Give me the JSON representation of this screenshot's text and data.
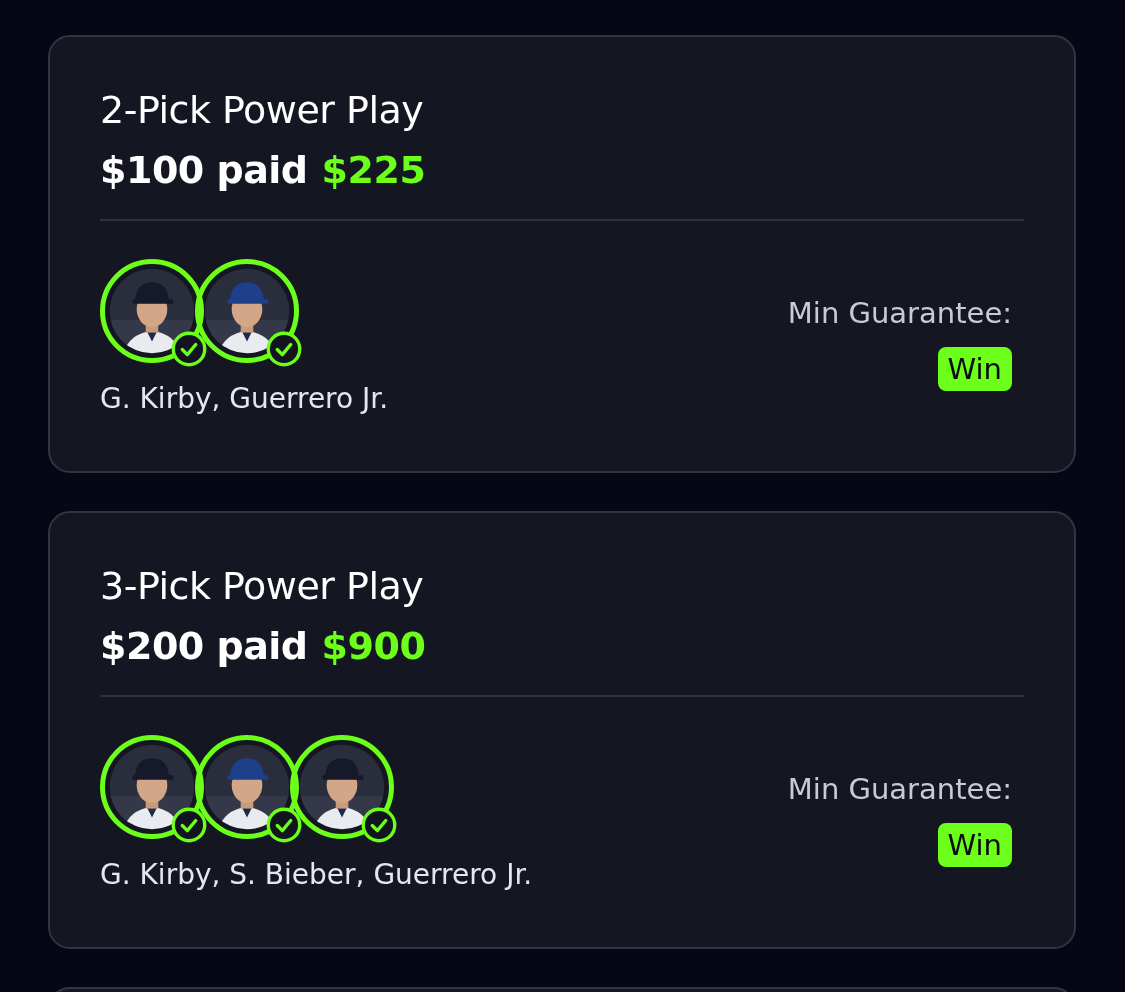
{
  "entries": [
    {
      "title": "2-Pick Power Play",
      "stake": "$100 paid",
      "payout": "$225",
      "picks": [
        {
          "won": true
        },
        {
          "won": true
        }
      ],
      "players": "G. Kirby, Guerrero Jr.",
      "guarantee_label": "Min Guarantee:",
      "guarantee_badge": "Win"
    },
    {
      "title": "3-Pick Power Play",
      "stake": "$200 paid",
      "payout": "$900",
      "picks": [
        {
          "won": true
        },
        {
          "won": true
        },
        {
          "won": true
        }
      ],
      "players": "G. Kirby, S. Bieber, Guerrero Jr.",
      "guarantee_label": "Min Guarantee:",
      "guarantee_badge": "Win"
    }
  ]
}
